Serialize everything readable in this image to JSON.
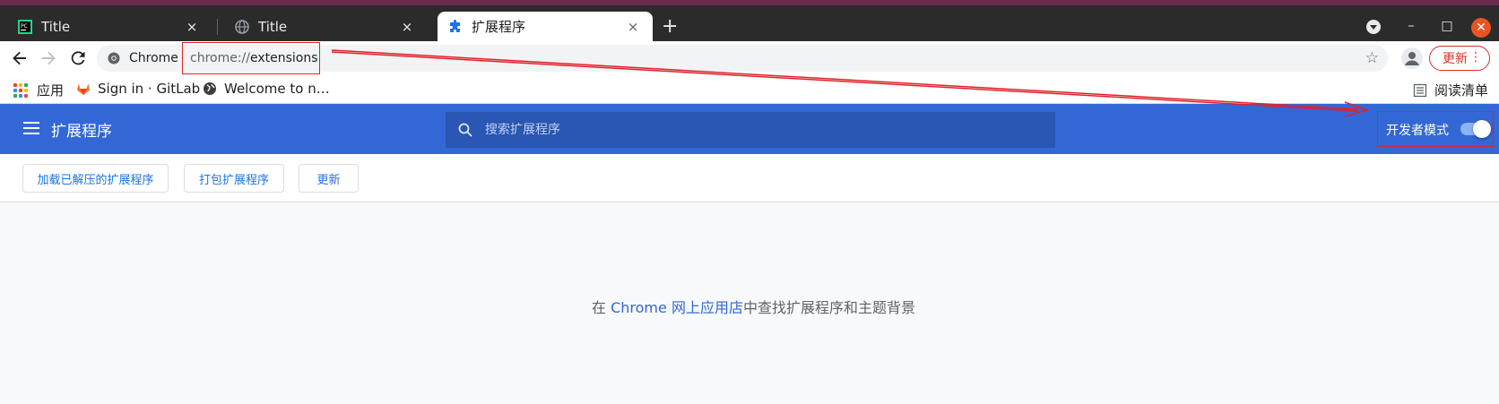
{
  "tabs": [
    {
      "title": "Title",
      "close": "×",
      "active": false
    },
    {
      "title": "Title",
      "close": "×",
      "active": false
    },
    {
      "title": "扩展程序",
      "close": "×",
      "active": true
    }
  ],
  "tabbar": {
    "new_tab": "+",
    "minimize": "–",
    "maximize": "□",
    "close": "✕"
  },
  "toolbar": {
    "site_chip": "Chrome",
    "url_scheme": "chrome://",
    "url_host": "extensions",
    "star": "☆",
    "update_label": "更新",
    "menu": "⋮"
  },
  "bookmarks": {
    "apps": "应用",
    "items": [
      "Sign in · GitLab",
      "Welcome to n…"
    ],
    "reading_list": "阅读清单",
    "apps_colors": [
      "#ea4335",
      "#fbbc04",
      "#34a853",
      "#4285f4",
      "#ea4335",
      "#fbbc04",
      "#34a853",
      "#4285f4",
      "#ea4335"
    ]
  },
  "header": {
    "title": "扩展程序",
    "search_placeholder": "搜索扩展程序",
    "dev_mode_label": "开发者模式",
    "dev_mode_on": true
  },
  "actions": {
    "load_unpacked": "加载已解压的扩展程序",
    "pack": "打包扩展程序",
    "update": "更新"
  },
  "main": {
    "prefix": "在 ",
    "link": "Chrome 网上应用店",
    "suffix": "中查找扩展程序和主题背景"
  },
  "colors": {
    "header_blue": "#3367d6",
    "annotation_red": "#e0222a",
    "update_red": "#d93025"
  }
}
